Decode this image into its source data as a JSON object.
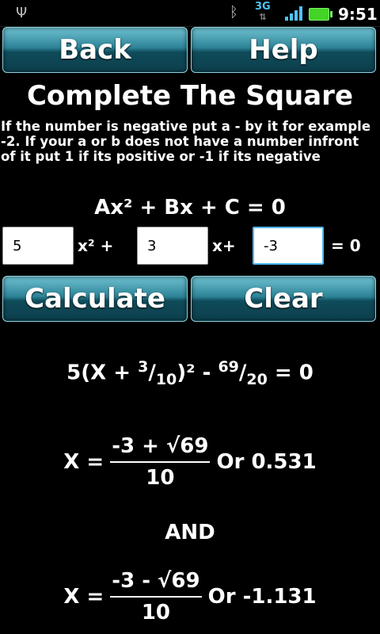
{
  "status_bar": {
    "network": "3G",
    "time": "9:51"
  },
  "buttons": {
    "back": "Back",
    "help": "Help",
    "calculate": "Calculate",
    "clear": "Clear"
  },
  "title": "Complete The Square",
  "instructions": "If the number is negative put a - by it for example -2. If your a or b does not have a number infront of it put 1 if its positive or -1 if its negative",
  "formula": "Ax² + Bx + C = 0",
  "inputs": {
    "a": "5",
    "b": "3",
    "c": "-3",
    "label_x2": "x² +",
    "label_x": "x+",
    "label_eq": "= 0"
  },
  "result": {
    "vertex_form": {
      "prefix": "5(X + ",
      "frac1_num": "3",
      "frac1_den": "10",
      "mid": ")² - ",
      "frac2_num": "69",
      "frac2_den": "20",
      "suffix": " = 0"
    },
    "root1": {
      "lhs": "X =",
      "numerator": "-3 + √69",
      "denominator": "10",
      "decimal": "Or 0.531"
    },
    "and_label": "AND",
    "root2": {
      "lhs": "X =",
      "numerator": "-3 - √69",
      "denominator": "10",
      "decimal": "Or -1.131"
    }
  }
}
